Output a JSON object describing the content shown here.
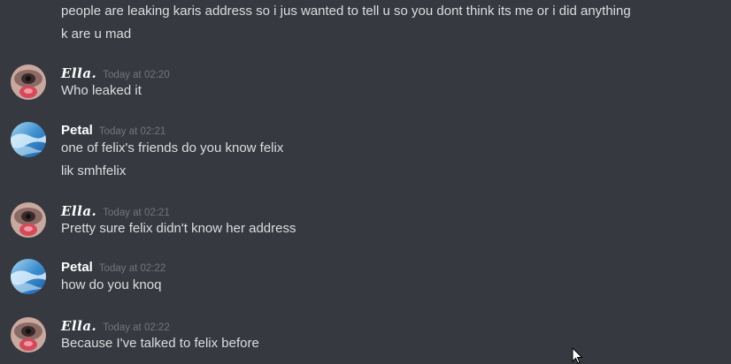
{
  "continued": [
    "people are leaking karis address so i jus wanted to tell u so you dont think its me or i did anything",
    "k are u mad"
  ],
  "messages": [
    {
      "author": "𝑬𝒍𝒍𝒂.",
      "timestamp": "Today at 02:20",
      "lines": [
        "Who leaked it"
      ]
    },
    {
      "author": "Petal",
      "timestamp": "Today at 02:21",
      "lines": [
        "one of felix's friends do you know felix",
        "lik smhfelix"
      ]
    },
    {
      "author": "𝑬𝒍𝒍𝒂.",
      "timestamp": "Today at 02:21",
      "lines": [
        "Pretty sure felix didn't know her address"
      ]
    },
    {
      "author": "Petal",
      "timestamp": "Today at 02:22",
      "lines": [
        "how do you knoq"
      ]
    },
    {
      "author": "𝑬𝒍𝒍𝒂.",
      "timestamp": "Today at 02:22",
      "lines": [
        "Because I've talked to felix before"
      ]
    }
  ],
  "colors": {
    "background": "#36393f",
    "username": "#ffffff",
    "message_text": "#dcddde",
    "timestamp": "#72767d"
  }
}
